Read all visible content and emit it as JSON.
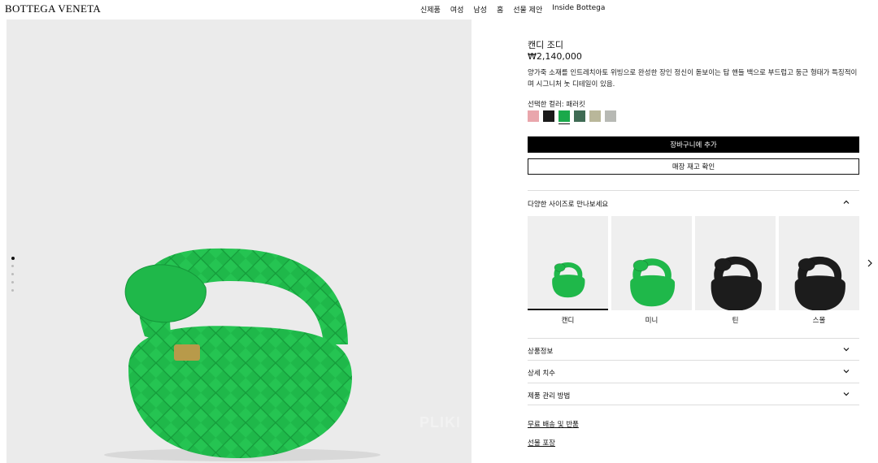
{
  "header": {
    "brand": "BOTTEGA VENETA",
    "nav": [
      "신제품",
      "여성",
      "남성",
      "홈",
      "선물 제안",
      "Inside Bottega"
    ]
  },
  "gallery": {
    "image_icon": "green-woven-handbag-image",
    "watermark": "PLIKI",
    "dot_count": 5,
    "active_dot": 0
  },
  "product": {
    "title": "캔디 조디",
    "price": "₩2,140,000",
    "description": "양가죽 소재를 인트레치아토 위빙으로 완성한 장인 정신이 돋보이는 탑 핸들 백으로 부드럽고 둥근 형태가 특징적이며 시그니처 놋 디테일이 있음.",
    "color_label": "선택한 컬러: 패러킷",
    "swatches": [
      {
        "color": "#e9a6ac",
        "selected": false
      },
      {
        "color": "#1a1a1a",
        "selected": false
      },
      {
        "color": "#1aa94b",
        "selected": true
      },
      {
        "color": "#3f6b54",
        "selected": false
      },
      {
        "color": "#b9b79a",
        "selected": false
      },
      {
        "color": "#b7b9b4",
        "selected": false
      }
    ],
    "add_to_cart": "장바구니에 추가",
    "check_store": "매장 재고 확인"
  },
  "sizes_section": {
    "title": "다양한 사이즈로 만나보세요",
    "items": [
      {
        "label": "캔디",
        "color": "#1fb84a",
        "selected": true
      },
      {
        "label": "미니",
        "color": "#1fb84a",
        "selected": false
      },
      {
        "label": "틴",
        "color": "#1c1c1c",
        "selected": false
      },
      {
        "label": "스몰",
        "color": "#1c1c1c",
        "selected": false
      }
    ],
    "next_icon": "chevron-right-icon"
  },
  "accordions": [
    "상품정보",
    "상세 치수",
    "제품 관리 방법"
  ],
  "links": [
    "무료 배송 및 반품",
    "선물 포장"
  ]
}
